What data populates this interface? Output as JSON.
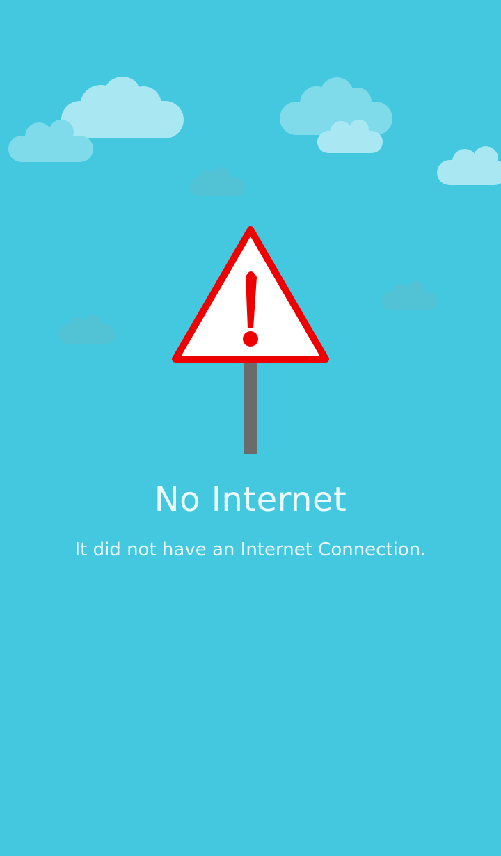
{
  "screen": {
    "title": "No Internet",
    "message": "It did not have an Internet Connection."
  },
  "icons": {
    "warning": "warning-sign-icon",
    "clouds": "cloud-icon"
  },
  "colors": {
    "background": "#43c8df",
    "cloud_light": "#a9e8f3",
    "cloud_mid": "#7fdbea",
    "cloud_faint": "#52c3d5",
    "sign_border": "#ee0000",
    "sign_fill": "#ffffff",
    "exclamation": "#ee0000",
    "pole": "#6b6b6b",
    "title_text": "#eaf9fc",
    "message_text": "#eaf9fc"
  }
}
